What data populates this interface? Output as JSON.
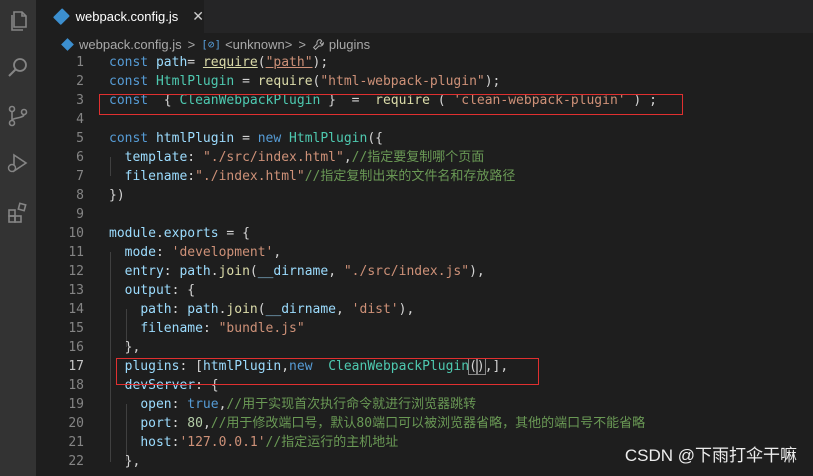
{
  "tab": {
    "title": "webpack.config.js",
    "close": "✕"
  },
  "breadcrumb": {
    "file": "webpack.config.js",
    "scope_symbol": "[⊘]",
    "scope": "<unknown>",
    "property": "plugins",
    "sep": ">"
  },
  "lines": [
    {
      "n": "1",
      "tokens": [
        [
          "kw",
          "const "
        ],
        [
          "var",
          "path"
        ],
        [
          "",
          "= "
        ],
        [
          "fn und",
          "require"
        ],
        [
          "",
          "("
        ],
        [
          "strund",
          "\"path\""
        ],
        [
          "",
          ");"
        ]
      ]
    },
    {
      "n": "2",
      "tokens": [
        [
          "kw",
          "const "
        ],
        [
          "cls",
          "HtmlPlugin"
        ],
        [
          "",
          " = "
        ],
        [
          "fn",
          "require"
        ],
        [
          "",
          "("
        ],
        [
          "str",
          "\"html-webpack-plugin\""
        ],
        [
          "",
          ");"
        ]
      ]
    },
    {
      "n": "3",
      "tokens": [
        [
          "kw",
          "const "
        ],
        [
          "",
          " { "
        ],
        [
          "cls",
          "CleanWebpackPlugin"
        ],
        [
          "",
          " }  =  "
        ],
        [
          "fn",
          "require"
        ],
        [
          "",
          " ( "
        ],
        [
          "str",
          "'clean-webpack-plugin'"
        ],
        [
          "",
          " ) ;"
        ]
      ]
    },
    {
      "n": "4",
      "tokens": []
    },
    {
      "n": "5",
      "tokens": [
        [
          "kw",
          "const "
        ],
        [
          "var",
          "htmlPlugin"
        ],
        [
          "",
          " = "
        ],
        [
          "kw",
          "new "
        ],
        [
          "cls",
          "HtmlPlugin"
        ],
        [
          "",
          "({"
        ]
      ]
    },
    {
      "n": "6",
      "tokens": [
        [
          "",
          "  "
        ],
        [
          "var",
          "template"
        ],
        [
          "",
          ": "
        ],
        [
          "str",
          "\"./src/index.html\""
        ],
        [
          "",
          ","
        ],
        [
          "cmt",
          "//指定要复制哪个页面"
        ]
      ]
    },
    {
      "n": "7",
      "tokens": [
        [
          "",
          "  "
        ],
        [
          "var",
          "filename"
        ],
        [
          "",
          ":"
        ],
        [
          "str",
          "\"./index.html\""
        ],
        [
          "cmt",
          "//指定复制出来的文件名和存放路径"
        ]
      ]
    },
    {
      "n": "8",
      "tokens": [
        [
          "",
          "})"
        ]
      ]
    },
    {
      "n": "9",
      "tokens": []
    },
    {
      "n": "10",
      "tokens": [
        [
          "var",
          "module"
        ],
        [
          "",
          "."
        ],
        [
          "var",
          "exports"
        ],
        [
          "",
          " = {"
        ]
      ]
    },
    {
      "n": "11",
      "tokens": [
        [
          "",
          "  "
        ],
        [
          "var",
          "mode"
        ],
        [
          "",
          ": "
        ],
        [
          "str",
          "'development'"
        ],
        [
          "",
          ","
        ]
      ]
    },
    {
      "n": "12",
      "tokens": [
        [
          "",
          "  "
        ],
        [
          "var",
          "entry"
        ],
        [
          "",
          ": "
        ],
        [
          "var",
          "path"
        ],
        [
          "",
          "."
        ],
        [
          "fn",
          "join"
        ],
        [
          "",
          "("
        ],
        [
          "var",
          "__dirname"
        ],
        [
          "",
          ", "
        ],
        [
          "str",
          "\"./src/index.js\""
        ],
        [
          "",
          "),"
        ]
      ]
    },
    {
      "n": "13",
      "tokens": [
        [
          "",
          "  "
        ],
        [
          "var",
          "output"
        ],
        [
          "",
          ": {"
        ]
      ]
    },
    {
      "n": "14",
      "tokens": [
        [
          "",
          "    "
        ],
        [
          "var",
          "path"
        ],
        [
          "",
          ": "
        ],
        [
          "var",
          "path"
        ],
        [
          "",
          "."
        ],
        [
          "fn",
          "join"
        ],
        [
          "",
          "("
        ],
        [
          "var",
          "__dirname"
        ],
        [
          "",
          ", "
        ],
        [
          "str",
          "'dist'"
        ],
        [
          "",
          "),"
        ]
      ]
    },
    {
      "n": "15",
      "tokens": [
        [
          "",
          "    "
        ],
        [
          "var",
          "filename"
        ],
        [
          "",
          ": "
        ],
        [
          "str",
          "\"bundle.js\""
        ]
      ]
    },
    {
      "n": "16",
      "tokens": [
        [
          "",
          "  },"
        ]
      ]
    },
    {
      "n": "17",
      "tokens": [
        [
          "",
          "  "
        ],
        [
          "var",
          "plugins"
        ],
        [
          "",
          ": ["
        ],
        [
          "var",
          "htmlPlugin"
        ],
        [
          "",
          ","
        ],
        [
          "kw",
          "new  "
        ],
        [
          "cls",
          "CleanWebpackPlugin"
        ],
        [
          "bracket",
          "("
        ],
        [
          "bracket",
          ")"
        ],
        [
          "",
          ",],"
        ]
      ]
    },
    {
      "n": "18",
      "tokens": [
        [
          "",
          "  "
        ],
        [
          "var",
          "devServer"
        ],
        [
          "",
          ": {"
        ]
      ]
    },
    {
      "n": "19",
      "tokens": [
        [
          "",
          "    "
        ],
        [
          "var",
          "open"
        ],
        [
          "",
          ": "
        ],
        [
          "kw",
          "true"
        ],
        [
          "",
          ","
        ],
        [
          "cmt",
          "//用于实现首次执行命令就进行浏览器跳转"
        ]
      ]
    },
    {
      "n": "20",
      "tokens": [
        [
          "",
          "    "
        ],
        [
          "var",
          "port"
        ],
        [
          "",
          ": "
        ],
        [
          "num",
          "80"
        ],
        [
          "",
          ","
        ],
        [
          "cmt",
          "//用于修改端口号，默认80端口可以被浏览器省略，其他的端口号不能省略"
        ]
      ]
    },
    {
      "n": "21",
      "tokens": [
        [
          "",
          "    "
        ],
        [
          "var",
          "host"
        ],
        [
          "",
          ":"
        ],
        [
          "str",
          "'127.0.0.1'"
        ],
        [
          "cmt",
          "//指定运行的主机地址"
        ]
      ]
    },
    {
      "n": "22",
      "tokens": [
        [
          "",
          "  },"
        ]
      ]
    }
  ],
  "current_line": "17",
  "watermark": "CSDN @下雨打伞干嘛",
  "colors": {
    "keyword": "#569cd6",
    "variable": "#9cdcfe",
    "function": "#dcdcaa",
    "class": "#4ec9b0",
    "string": "#ce9178",
    "number": "#b5cea8",
    "comment": "#6a9955",
    "highlight_box": "#e03030"
  }
}
